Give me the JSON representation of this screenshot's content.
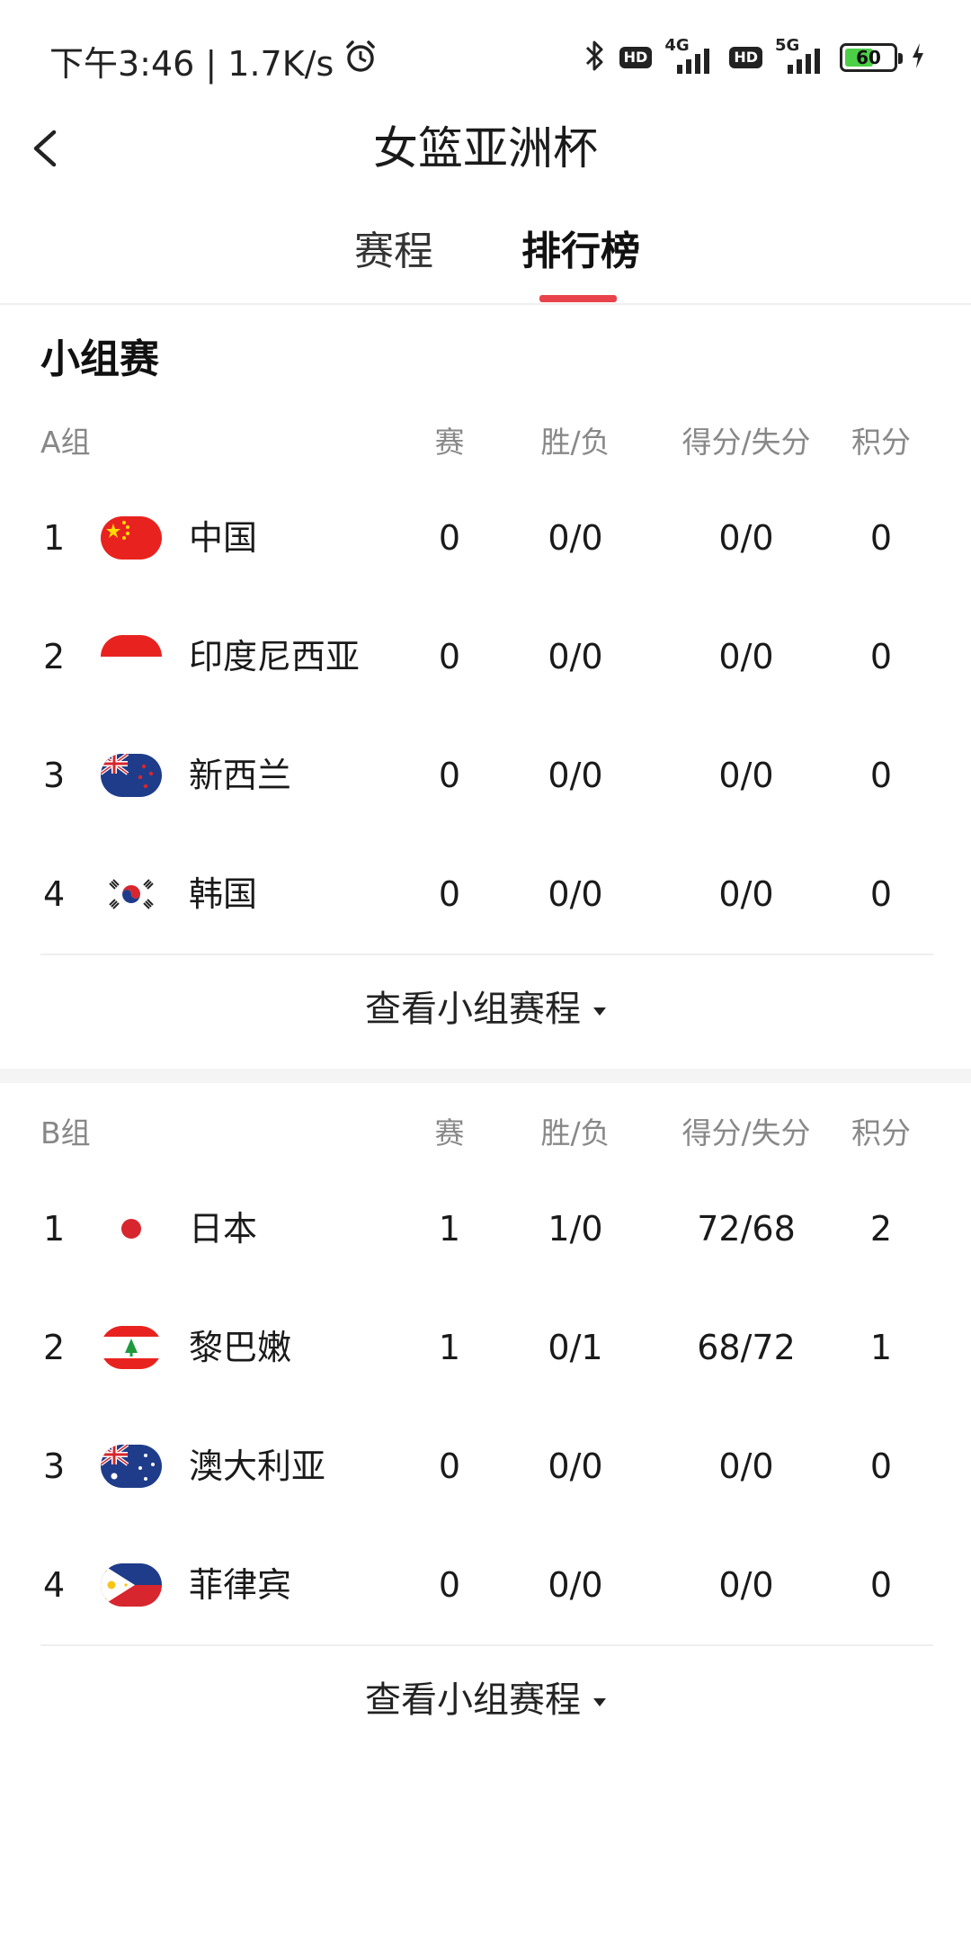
{
  "status_bar": {
    "time_speed": "下午3:46 | 1.7K/s",
    "sim1_badge": "HD",
    "sim1_network": "4G",
    "sim2_badge": "HD",
    "sim2_network": "5G",
    "battery_level": "60",
    "battery_fraction": 0.6,
    "icons": [
      "alarm-icon",
      "bluetooth-icon",
      "charging-icon"
    ]
  },
  "header": {
    "title": "女篮亚洲杯",
    "back_icon": "chevron-left-icon"
  },
  "tabs": [
    {
      "label": "赛程",
      "active": false
    },
    {
      "label": "排行榜",
      "active": true
    }
  ],
  "accent_color": "#e8434b",
  "section_title": "小组赛",
  "columns": {
    "games": "赛",
    "win_loss": "胜/负",
    "points_for_against": "得分/失分",
    "standing_points": "积分"
  },
  "groups": [
    {
      "name": "A组",
      "more_label": "查看小组赛程",
      "rows": [
        {
          "rank": "1",
          "team": "中国",
          "flag": "china-flag-icon",
          "games": "0",
          "win_loss": "0/0",
          "score": "0/0",
          "points": "0"
        },
        {
          "rank": "2",
          "team": "印度尼西亚",
          "flag": "indonesia-flag-icon",
          "games": "0",
          "win_loss": "0/0",
          "score": "0/0",
          "points": "0"
        },
        {
          "rank": "3",
          "team": "新西兰",
          "flag": "new-zealand-flag-icon",
          "games": "0",
          "win_loss": "0/0",
          "score": "0/0",
          "points": "0"
        },
        {
          "rank": "4",
          "team": "韩国",
          "flag": "korea-flag-icon",
          "games": "0",
          "win_loss": "0/0",
          "score": "0/0",
          "points": "0"
        }
      ]
    },
    {
      "name": "B组",
      "more_label": "查看小组赛程",
      "rows": [
        {
          "rank": "1",
          "team": "日本",
          "flag": "japan-flag-icon",
          "games": "1",
          "win_loss": "1/0",
          "score": "72/68",
          "points": "2"
        },
        {
          "rank": "2",
          "team": "黎巴嫩",
          "flag": "lebanon-flag-icon",
          "games": "1",
          "win_loss": "0/1",
          "score": "68/72",
          "points": "1"
        },
        {
          "rank": "3",
          "team": "澳大利亚",
          "flag": "australia-flag-icon",
          "games": "0",
          "win_loss": "0/0",
          "score": "0/0",
          "points": "0"
        },
        {
          "rank": "4",
          "team": "菲律宾",
          "flag": "philippines-flag-icon",
          "games": "0",
          "win_loss": "0/0",
          "score": "0/0",
          "points": "0"
        }
      ]
    }
  ]
}
